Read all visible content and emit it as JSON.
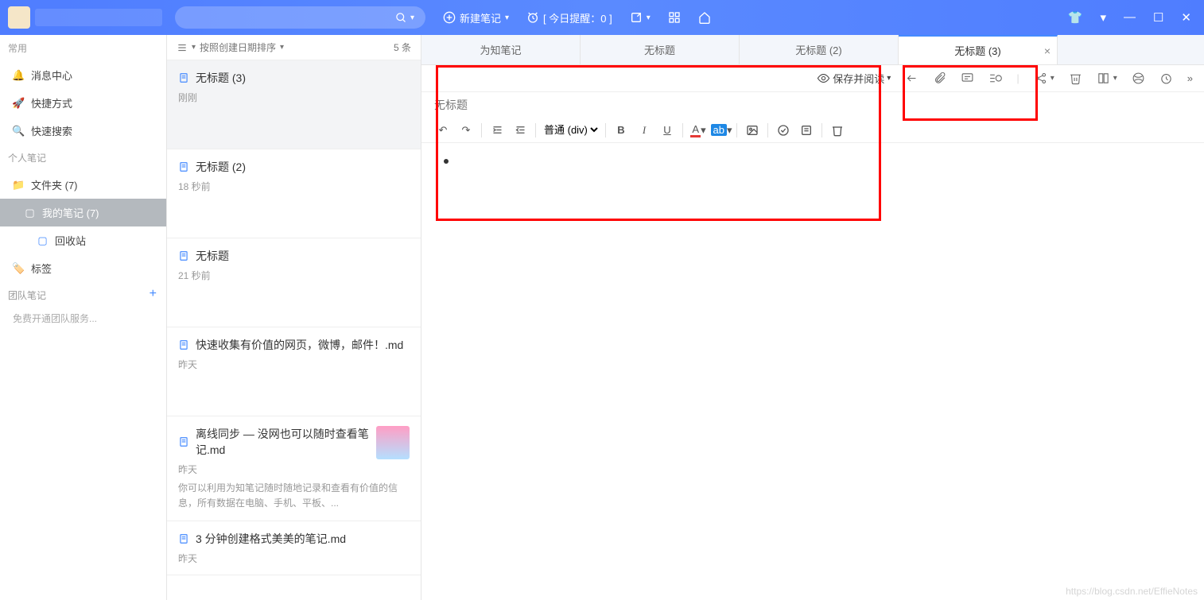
{
  "header": {
    "new_note": "新建笔记",
    "today_reminder": "[ 今日提醒：0 ]"
  },
  "sidebar": {
    "group1": "常用",
    "msg_center": "消息中心",
    "shortcut": "快捷方式",
    "quick_search": "快速搜索",
    "group2": "个人笔记",
    "folder": "文件夹  (7)",
    "my_notes": "我的笔记 (7)",
    "recycle": "回收站",
    "tags": "标签",
    "group3": "团队笔记",
    "open_team": "免费开通团队服务..."
  },
  "list": {
    "sort": "按照创建日期排序",
    "count": "5 条",
    "items": [
      {
        "title": "无标题 (3)",
        "meta": "刚刚",
        "snippet": ""
      },
      {
        "title": "无标题 (2)",
        "meta": "18 秒前",
        "snippet": ""
      },
      {
        "title": "无标题",
        "meta": "21 秒前",
        "snippet": ""
      },
      {
        "title": "快速收集有价值的网页，微博，邮件！.md",
        "meta": "昨天",
        "snippet": ""
      },
      {
        "title": "离线同步 — 没网也可以随时查看笔记.md",
        "meta": "昨天",
        "snippet": "你可以利用为知笔记随时随地记录和查看有价值的信息，所有数据在电脑、手机、平板、..."
      },
      {
        "title": "3 分钟创建格式美美的笔记.md",
        "meta": "昨天",
        "snippet": ""
      }
    ]
  },
  "tabs": [
    {
      "label": "为知笔记"
    },
    {
      "label": "无标题"
    },
    {
      "label": "无标题 (2)"
    },
    {
      "label": "无标题 (3)",
      "active": true
    }
  ],
  "editor": {
    "title_placeholder": "无标题",
    "save_read": "保存并阅读",
    "paragraph": "普通 (div)"
  },
  "watermark": "https://blog.csdn.net/EffieNotes"
}
